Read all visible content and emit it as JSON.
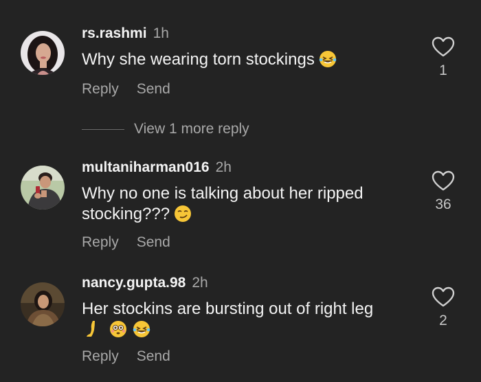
{
  "comments": [
    {
      "username": "rs.rashmi",
      "time": "1h",
      "text": "Why she wearing torn stockings",
      "text_emoji": "grinning-squint-tears",
      "likes": "1",
      "reply_label": "Reply",
      "send_label": "Send"
    },
    {
      "username": "multaniharman016",
      "time": "2h",
      "text": "Why no one is talking about her ripped stocking???",
      "text_emoji": "smirk",
      "likes": "36",
      "reply_label": "Reply",
      "send_label": "Send"
    },
    {
      "username": "nancy.gupta.98",
      "time": "2h",
      "text": "Her stockins are bursting out of right leg",
      "text_emoji": "leg flushed grinning-squint-tears",
      "likes": "2",
      "reply_label": "Reply",
      "send_label": "Send"
    }
  ],
  "view_more_replies": "View 1 more reply",
  "colors": {
    "background": "#232323",
    "secondary_text": "#a8a8a8",
    "primary_text": "#f4f4f4"
  }
}
